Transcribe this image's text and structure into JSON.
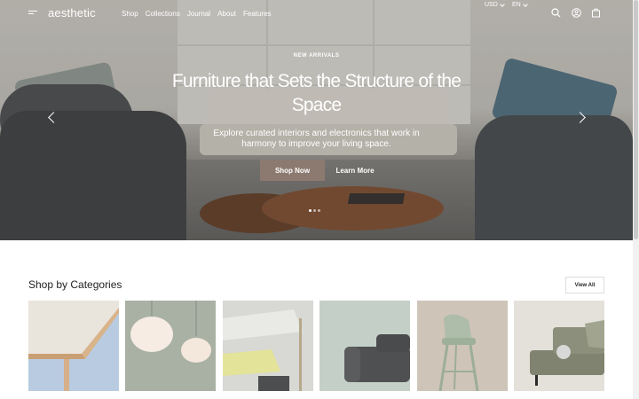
{
  "nav": {
    "logo": "aesthetic",
    "menu": [
      "Shop",
      "Collections",
      "Journal",
      "About",
      "Features"
    ],
    "currency": "USD",
    "language": "EN",
    "icons": [
      "hamburger-icon",
      "search-icon",
      "account-icon",
      "bag-icon"
    ]
  },
  "hero": {
    "eyebrow": "NEW ARRIVALS",
    "title": "Furniture that Sets the Structure of the Space",
    "subtitle": "Explore curated interiors and electronics that work in harmony to improve your living space.",
    "primary_button": "Shop Now",
    "secondary_button": "Learn More",
    "slides_total": 3,
    "slide_active": 1
  },
  "categories": {
    "title": "Shop by Categories",
    "view_all": "View All",
    "cards": [
      {
        "name": "table-corner",
        "bg": "#b8cbe0"
      },
      {
        "name": "pendant-lamps",
        "bg": "#a9b1a4"
      },
      {
        "name": "shelf-yellow",
        "bg": "#c9c9c6"
      },
      {
        "name": "grey-sofa",
        "bg": "#c4cfc7"
      },
      {
        "name": "bar-stool",
        "bg": "#cfc4b8"
      },
      {
        "name": "daybed",
        "bg": "#dedad4"
      }
    ]
  },
  "colors": {
    "accent": "#8c7a70",
    "text": "#222222"
  }
}
